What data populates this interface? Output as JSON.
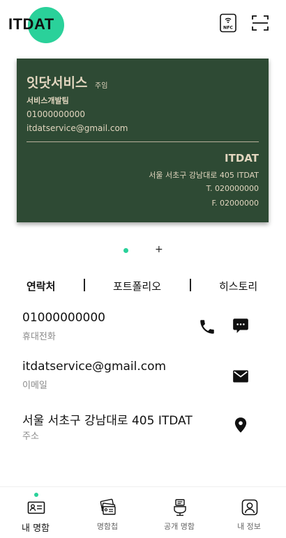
{
  "header": {
    "logo_text": "ITDAT",
    "nfc_icon": "nfc-icon",
    "scan_icon": "qr-scan-icon",
    "brand_color": "#2ad19a"
  },
  "card": {
    "background": "#2e4a34",
    "name": "잇닷서비스",
    "title": "주임",
    "department": "서비스개발팀",
    "phone": "01000000000",
    "email": "itdatservice@gmail.com",
    "company": "ITDAT",
    "address": "서울 서초구 강남대로 405 ITDAT",
    "tel": "T. 020000000",
    "fax": "F. 02000000"
  },
  "pager": {
    "add_label": "+"
  },
  "tabs": [
    {
      "label": "연락처",
      "active": true
    },
    {
      "label": "포트폴리오",
      "active": false
    },
    {
      "label": "히스토리",
      "active": false
    }
  ],
  "contacts": [
    {
      "value": "01000000000",
      "label": "휴대전화",
      "icons": [
        "phone-icon",
        "message-icon"
      ]
    },
    {
      "value": "itdatservice@gmail.com",
      "label": "이메일",
      "icons": [
        "mail-icon"
      ]
    },
    {
      "value": "서울 서초구 강남대로 405 ITDAT",
      "label": "주소",
      "icons": [
        "location-pin-icon"
      ]
    }
  ],
  "bottom_nav": [
    {
      "label": "내 명함",
      "icon": "my-card-icon",
      "active": true
    },
    {
      "label": "명함첩",
      "icon": "card-book-icon",
      "active": false
    },
    {
      "label": "공개 명함",
      "icon": "public-card-icon",
      "active": false
    },
    {
      "label": "내 정보",
      "icon": "profile-icon",
      "active": false
    }
  ]
}
